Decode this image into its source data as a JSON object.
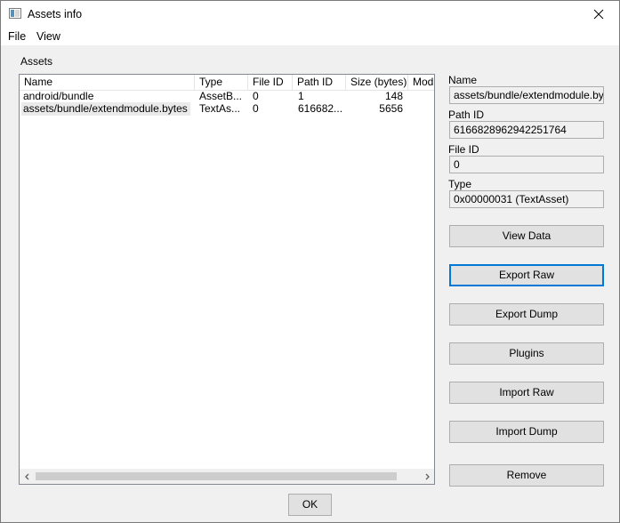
{
  "window": {
    "title": "Assets info",
    "close_glyph": "✕"
  },
  "menu": {
    "file": "File",
    "view": "View"
  },
  "assets": {
    "group_label": "Assets",
    "columns": [
      "Name",
      "Type",
      "File ID",
      "Path ID",
      "Size (bytes)",
      "Modifi"
    ],
    "rows": [
      {
        "name": "android/bundle",
        "type": "AssetB...",
        "file_id": "0",
        "path_id": "1",
        "size": "148"
      },
      {
        "name": "assets/bundle/extendmodule.bytes",
        "type": "TextAs...",
        "file_id": "0",
        "path_id": "616682...",
        "size": "5656"
      }
    ],
    "selected_row": 1,
    "scroll_left_glyph": "‹",
    "scroll_right_glyph": "›"
  },
  "details": {
    "name_label": "Name",
    "name_value": "assets/bundle/extendmodule.bytes",
    "path_id_label": "Path ID",
    "path_id_value": "6166828962942251764",
    "file_id_label": "File ID",
    "file_id_value": "0",
    "type_label": "Type",
    "type_value": "0x00000031 (TextAsset)"
  },
  "buttons": {
    "view_data": "View Data",
    "export_raw": "Export Raw",
    "export_dump": "Export Dump",
    "plugins": "Plugins",
    "import_raw": "Import Raw",
    "import_dump": "Import Dump",
    "remove": "Remove",
    "ok": "OK"
  },
  "icons": {
    "app": "app-window-icon",
    "close": "close-icon"
  }
}
